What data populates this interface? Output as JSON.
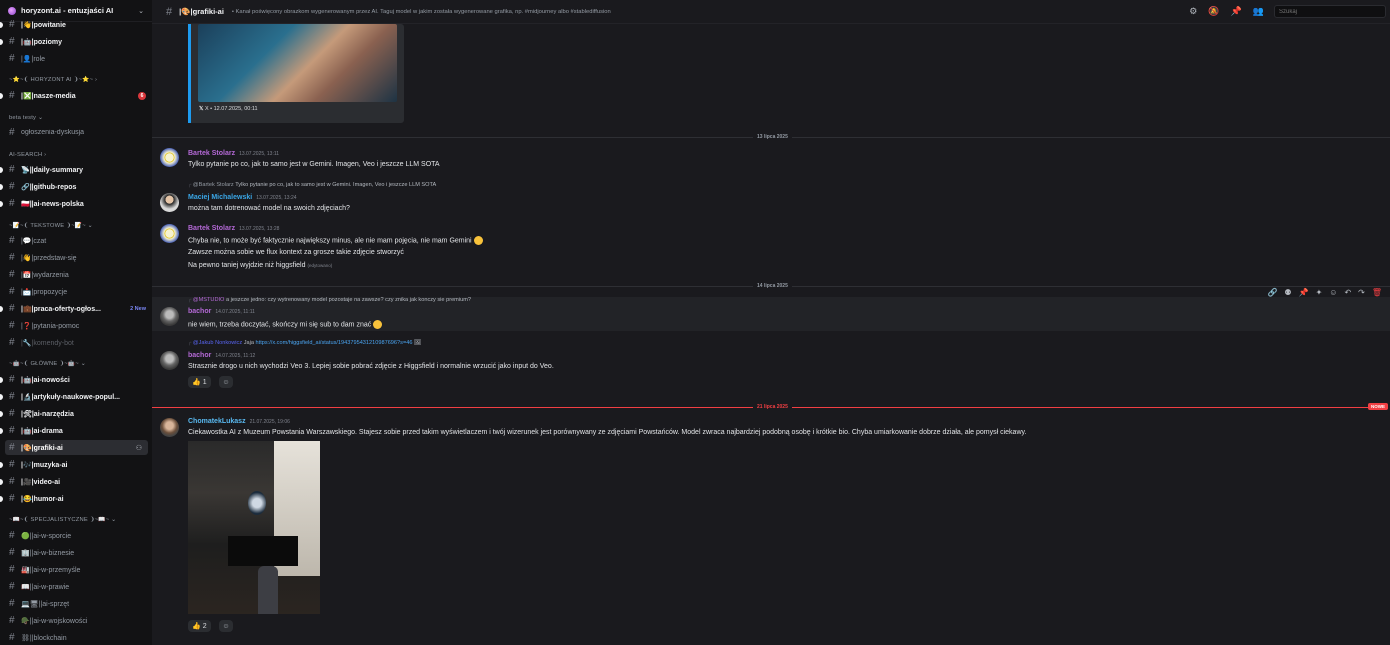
{
  "server": {
    "name": "horyzont.ai - entuzjaści AI"
  },
  "sidebar": {
    "channels": {
      "powitanie": "|👋|powitanie",
      "poziomy": "|🤖|poziomy",
      "role": "|👤|role",
      "nasze_media": "|❎|nasze-media",
      "nasze_media_badge": "6",
      "ogloszenia": "ogłoszenia-dyskusja",
      "daily": "📡||daily-summary",
      "github": "🔗||github-repos",
      "news": "🇵🇱||ai-news-polska",
      "czat": "|💬|czat",
      "przedstaw": "|👋|przedstaw-się",
      "wydarzenia": "|📅|wydarzenia",
      "propozycje": "|📩|propozycje",
      "praca": "|💼|praca-oferty-ogłos...",
      "praca_badge": "2 New",
      "pytania": "|❓|pytania-pomoc",
      "komendy": "|🔧|komendy-bot",
      "nowosci": "|🤖|ai-nowości",
      "artykuly": "|🔬|artykuły-naukowe-popul...",
      "narzedzia": "|🛠|ai-narzędzia",
      "drama": "|🤖|ai-drama",
      "grafiki": "|🎨|grafiki-ai",
      "muzyka": "|🎶|muzyka-ai",
      "video": "|🎥|video-ai",
      "humor": "|😂|humor-ai",
      "sport": "🟢||ai-w-sporcie",
      "biznes": "🏢||ai-w-biznesie",
      "przemysl": "🏭||ai-w-przemyśle",
      "prawo": "📖||ai-w-prawie",
      "sprzet": "💻🖥||ai-sprzęt",
      "wojsko": "🪖||ai-w-wojskowości",
      "blockchain": "⛓||blockchain"
    },
    "categories": {
      "horyzont": "~⭐~❨ HORYZONT AI ❩~⭐~ ›",
      "beta": "beta testy ⌄",
      "search": "AI-SEARCH ›",
      "tekstowe": "~📝~❨ TEKSTOWE ❩~📝~ ⌄",
      "glowne": "~🤖~❨ GŁÓWNE ❩~🤖~ ⌄",
      "specjalistyczne": "~📖~❨ SPECJALISTYCZNE ❩~📖~ ⌄"
    }
  },
  "topbar": {
    "title": "|🎨|grafiki-ai",
    "topic": "• Kanał poświęcony obrazkom wygenerowanym przez AI. Taguj model w jakim została wygenerowane grafika, np. #midjourney albo #stablediffusion",
    "search_placeholder": "Szukaj"
  },
  "embed": {
    "footer": "X • 12.07.2025, 00:11"
  },
  "dividers": {
    "d1": "13 lipca 2025",
    "d2": "14 lipca 2025",
    "d3": "21 lipca 2025",
    "new": "NOWE"
  },
  "messages": {
    "m1": {
      "author": "Bartek Stolarz",
      "time": "13.07.2025, 13:11",
      "text": "Tylko pytanie po co, jak to samo jest w Gemini. Imagen, Veo i jeszcze LLM SOTA"
    },
    "m2": {
      "reply_mention": "@Bartek Stolarz",
      "reply_text": "Tylko pytanie po co, jak to samo jest w Gemini. Imagen, Veo i jeszcze LLM SOTA",
      "author": "Maciej Michalewski",
      "time": "13.07.2025, 13:24",
      "text": "można tam dotrenować model na swoich zdjęciach?"
    },
    "m3": {
      "author": "Bartek Stolarz",
      "time": "13.07.2025, 13:28",
      "line1": "Chyba nie, to może być faktycznie największy minus, ale nie mam pojęcia, nie mam Gemini",
      "line2": "Zawsze można sobie we flux kontext za grosze takie zdjęcie stworzyć",
      "line3": "Na pewno taniej wyjdzie niż higgsfield",
      "edited": "(edytowano)"
    },
    "m4": {
      "reply_mention": "@MSTUDIO",
      "reply_text": "a jeszcze jedno: czy wytrenowany model pozostaje na zawsze? czy znika jak konczy sie premium?",
      "author": "bachor",
      "time": "14.07.2025, 11:11",
      "text": "nie wiem, trzeba doczytać, skończy mi się sub to dam znać"
    },
    "m5": {
      "reply_mention": "@Jakub Nonkowicz",
      "reply_text": "Jaja",
      "reply_link": "https://x.com/higgsfield_ai/status/1943795431210987696?s=46",
      "author": "bachor",
      "time": "14.07.2025, 11:12",
      "text": "Strasznie drogo u nich wychodzi Veo 3. Lepiej sobie pobrać zdjęcie z Higgsfield i normalnie wrzucić jako input do Veo.",
      "reaction_count": "1"
    },
    "m6": {
      "author": "ChomatekLukasz",
      "time": "21.07.2025, 19:06",
      "text": "Ciekawostka AI z Muzeum Powstania Warszawskiego. Stajesz sobie przed takim wyświetlaczem i twój wizerunek jest porównywany ze zdjęciami Powstańców. Model zwraca najbardziej podobną osobę i krótkie bio. Chyba umiarkowanie dobrze działa, ale pomysł ciekawy.",
      "reaction_count": "2"
    }
  },
  "colors": {
    "bartek": "#b469d6",
    "maciej": "#3aa6e6",
    "bachor": "#b469d6",
    "chomatek": "#59b9f0",
    "new_line": "#f23f43"
  }
}
